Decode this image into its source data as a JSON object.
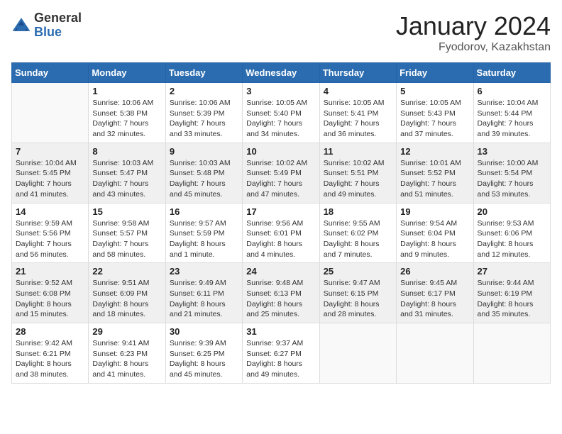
{
  "header": {
    "logo_general": "General",
    "logo_blue": "Blue",
    "month_title": "January 2024",
    "location": "Fyodorov, Kazakhstan"
  },
  "weekdays": [
    "Sunday",
    "Monday",
    "Tuesday",
    "Wednesday",
    "Thursday",
    "Friday",
    "Saturday"
  ],
  "weeks": [
    [
      {
        "num": "",
        "sunrise": "",
        "sunset": "",
        "daylight": ""
      },
      {
        "num": "1",
        "sunrise": "Sunrise: 10:06 AM",
        "sunset": "Sunset: 5:38 PM",
        "daylight": "Daylight: 7 hours and 32 minutes."
      },
      {
        "num": "2",
        "sunrise": "Sunrise: 10:06 AM",
        "sunset": "Sunset: 5:39 PM",
        "daylight": "Daylight: 7 hours and 33 minutes."
      },
      {
        "num": "3",
        "sunrise": "Sunrise: 10:05 AM",
        "sunset": "Sunset: 5:40 PM",
        "daylight": "Daylight: 7 hours and 34 minutes."
      },
      {
        "num": "4",
        "sunrise": "Sunrise: 10:05 AM",
        "sunset": "Sunset: 5:41 PM",
        "daylight": "Daylight: 7 hours and 36 minutes."
      },
      {
        "num": "5",
        "sunrise": "Sunrise: 10:05 AM",
        "sunset": "Sunset: 5:43 PM",
        "daylight": "Daylight: 7 hours and 37 minutes."
      },
      {
        "num": "6",
        "sunrise": "Sunrise: 10:04 AM",
        "sunset": "Sunset: 5:44 PM",
        "daylight": "Daylight: 7 hours and 39 minutes."
      }
    ],
    [
      {
        "num": "7",
        "sunrise": "Sunrise: 10:04 AM",
        "sunset": "Sunset: 5:45 PM",
        "daylight": "Daylight: 7 hours and 41 minutes."
      },
      {
        "num": "8",
        "sunrise": "Sunrise: 10:03 AM",
        "sunset": "Sunset: 5:47 PM",
        "daylight": "Daylight: 7 hours and 43 minutes."
      },
      {
        "num": "9",
        "sunrise": "Sunrise: 10:03 AM",
        "sunset": "Sunset: 5:48 PM",
        "daylight": "Daylight: 7 hours and 45 minutes."
      },
      {
        "num": "10",
        "sunrise": "Sunrise: 10:02 AM",
        "sunset": "Sunset: 5:49 PM",
        "daylight": "Daylight: 7 hours and 47 minutes."
      },
      {
        "num": "11",
        "sunrise": "Sunrise: 10:02 AM",
        "sunset": "Sunset: 5:51 PM",
        "daylight": "Daylight: 7 hours and 49 minutes."
      },
      {
        "num": "12",
        "sunrise": "Sunrise: 10:01 AM",
        "sunset": "Sunset: 5:52 PM",
        "daylight": "Daylight: 7 hours and 51 minutes."
      },
      {
        "num": "13",
        "sunrise": "Sunrise: 10:00 AM",
        "sunset": "Sunset: 5:54 PM",
        "daylight": "Daylight: 7 hours and 53 minutes."
      }
    ],
    [
      {
        "num": "14",
        "sunrise": "Sunrise: 9:59 AM",
        "sunset": "Sunset: 5:56 PM",
        "daylight": "Daylight: 7 hours and 56 minutes."
      },
      {
        "num": "15",
        "sunrise": "Sunrise: 9:58 AM",
        "sunset": "Sunset: 5:57 PM",
        "daylight": "Daylight: 7 hours and 58 minutes."
      },
      {
        "num": "16",
        "sunrise": "Sunrise: 9:57 AM",
        "sunset": "Sunset: 5:59 PM",
        "daylight": "Daylight: 8 hours and 1 minute."
      },
      {
        "num": "17",
        "sunrise": "Sunrise: 9:56 AM",
        "sunset": "Sunset: 6:01 PM",
        "daylight": "Daylight: 8 hours and 4 minutes."
      },
      {
        "num": "18",
        "sunrise": "Sunrise: 9:55 AM",
        "sunset": "Sunset: 6:02 PM",
        "daylight": "Daylight: 8 hours and 7 minutes."
      },
      {
        "num": "19",
        "sunrise": "Sunrise: 9:54 AM",
        "sunset": "Sunset: 6:04 PM",
        "daylight": "Daylight: 8 hours and 9 minutes."
      },
      {
        "num": "20",
        "sunrise": "Sunrise: 9:53 AM",
        "sunset": "Sunset: 6:06 PM",
        "daylight": "Daylight: 8 hours and 12 minutes."
      }
    ],
    [
      {
        "num": "21",
        "sunrise": "Sunrise: 9:52 AM",
        "sunset": "Sunset: 6:08 PM",
        "daylight": "Daylight: 8 hours and 15 minutes."
      },
      {
        "num": "22",
        "sunrise": "Sunrise: 9:51 AM",
        "sunset": "Sunset: 6:09 PM",
        "daylight": "Daylight: 8 hours and 18 minutes."
      },
      {
        "num": "23",
        "sunrise": "Sunrise: 9:49 AM",
        "sunset": "Sunset: 6:11 PM",
        "daylight": "Daylight: 8 hours and 21 minutes."
      },
      {
        "num": "24",
        "sunrise": "Sunrise: 9:48 AM",
        "sunset": "Sunset: 6:13 PM",
        "daylight": "Daylight: 8 hours and 25 minutes."
      },
      {
        "num": "25",
        "sunrise": "Sunrise: 9:47 AM",
        "sunset": "Sunset: 6:15 PM",
        "daylight": "Daylight: 8 hours and 28 minutes."
      },
      {
        "num": "26",
        "sunrise": "Sunrise: 9:45 AM",
        "sunset": "Sunset: 6:17 PM",
        "daylight": "Daylight: 8 hours and 31 minutes."
      },
      {
        "num": "27",
        "sunrise": "Sunrise: 9:44 AM",
        "sunset": "Sunset: 6:19 PM",
        "daylight": "Daylight: 8 hours and 35 minutes."
      }
    ],
    [
      {
        "num": "28",
        "sunrise": "Sunrise: 9:42 AM",
        "sunset": "Sunset: 6:21 PM",
        "daylight": "Daylight: 8 hours and 38 minutes."
      },
      {
        "num": "29",
        "sunrise": "Sunrise: 9:41 AM",
        "sunset": "Sunset: 6:23 PM",
        "daylight": "Daylight: 8 hours and 41 minutes."
      },
      {
        "num": "30",
        "sunrise": "Sunrise: 9:39 AM",
        "sunset": "Sunset: 6:25 PM",
        "daylight": "Daylight: 8 hours and 45 minutes."
      },
      {
        "num": "31",
        "sunrise": "Sunrise: 9:37 AM",
        "sunset": "Sunset: 6:27 PM",
        "daylight": "Daylight: 8 hours and 49 minutes."
      },
      {
        "num": "",
        "sunrise": "",
        "sunset": "",
        "daylight": ""
      },
      {
        "num": "",
        "sunrise": "",
        "sunset": "",
        "daylight": ""
      },
      {
        "num": "",
        "sunrise": "",
        "sunset": "",
        "daylight": ""
      }
    ]
  ],
  "shaded_rows": [
    1,
    3
  ]
}
